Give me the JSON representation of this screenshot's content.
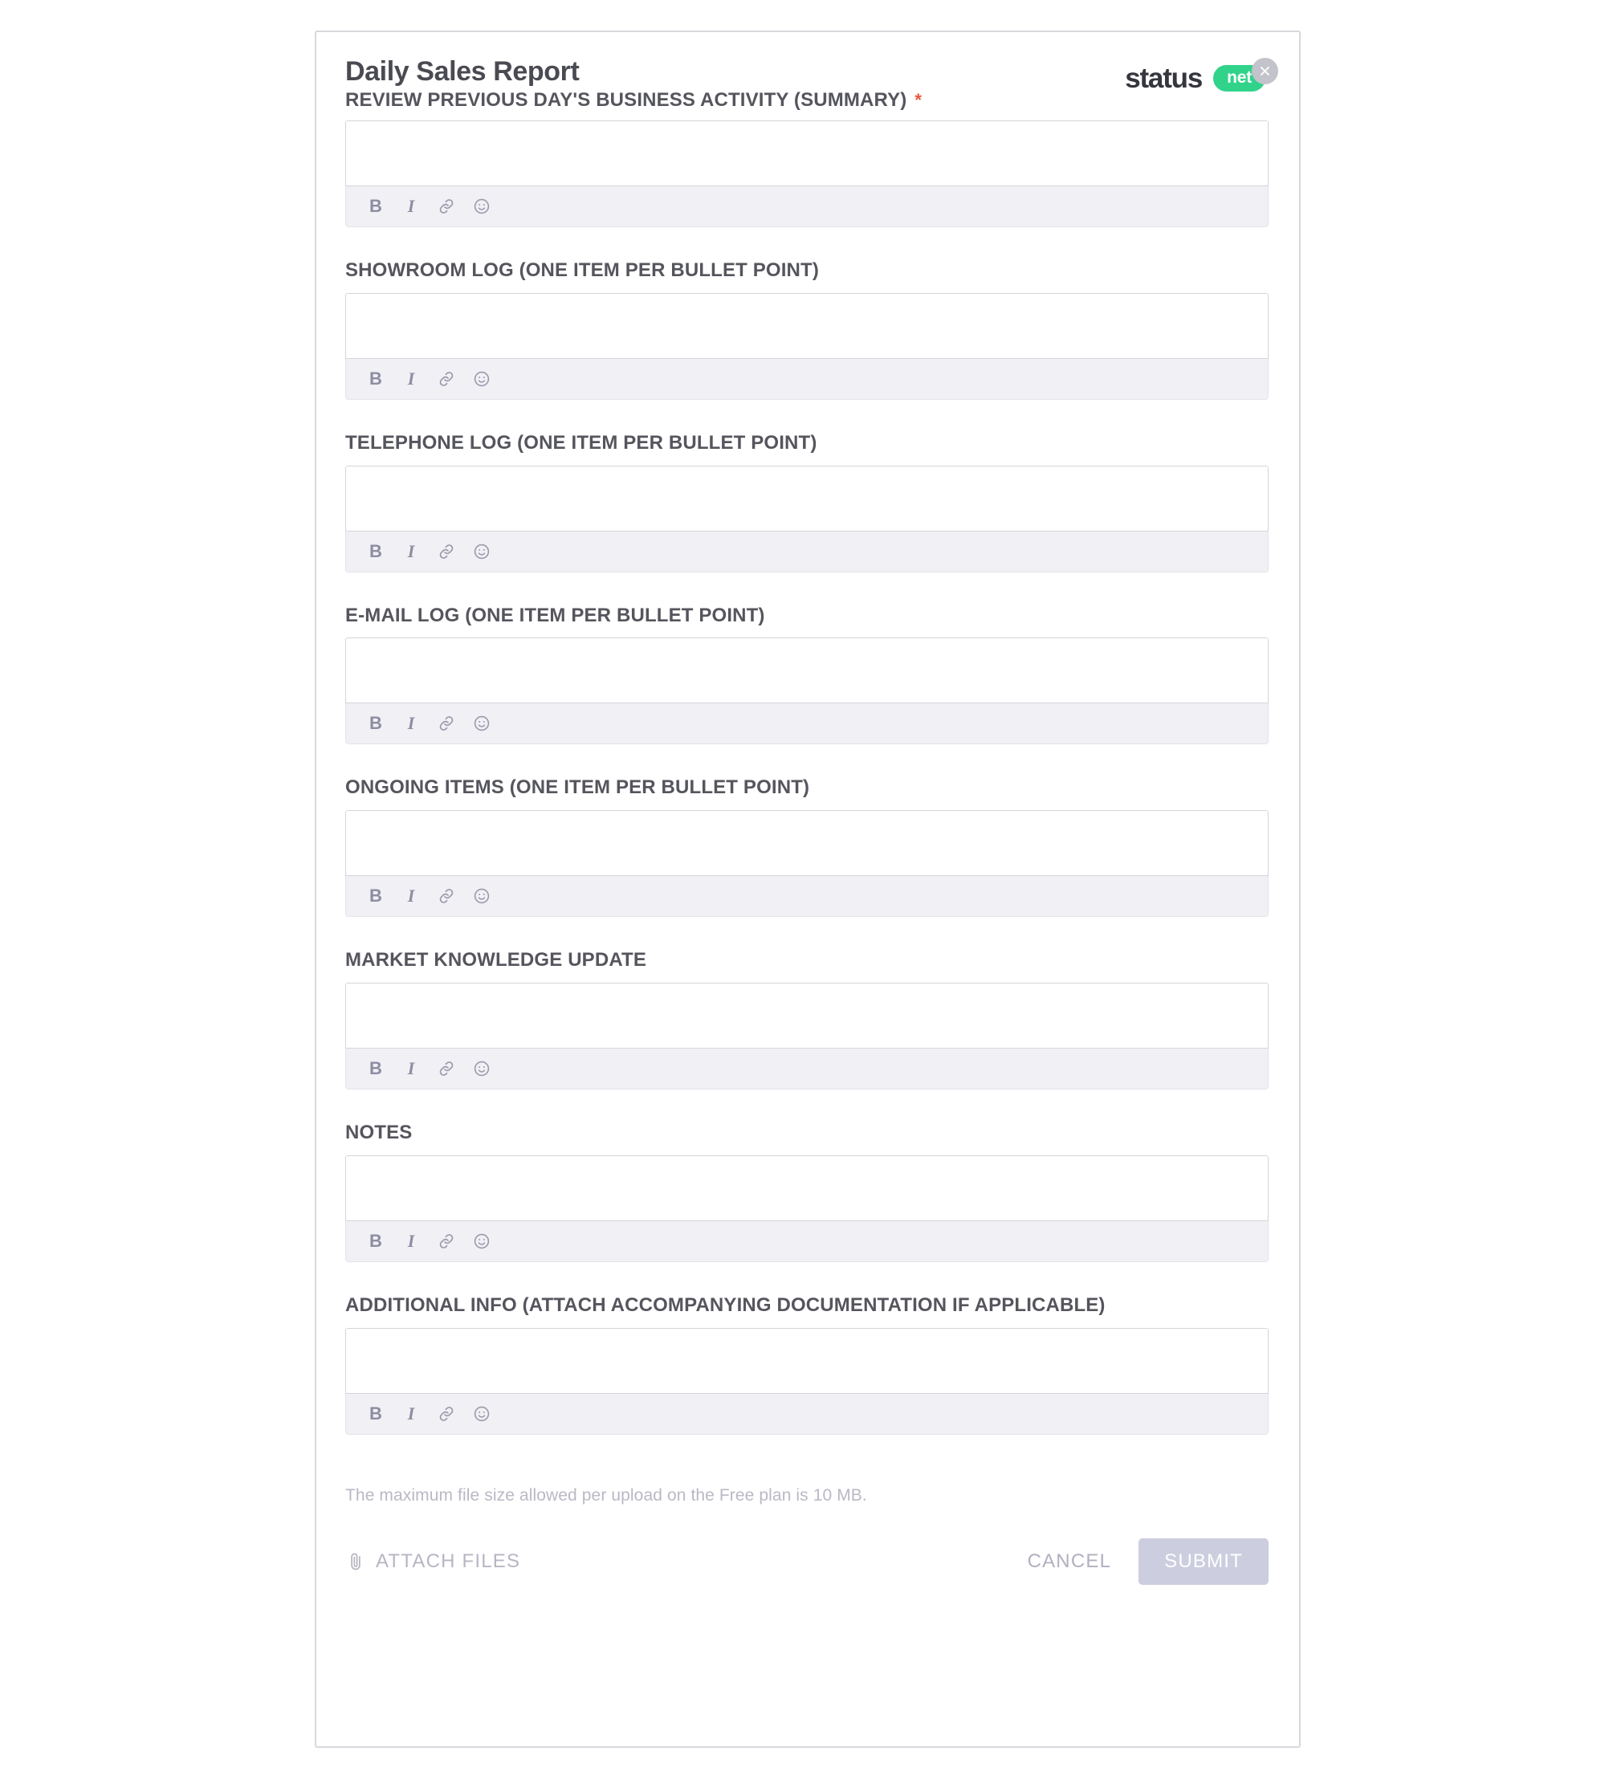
{
  "brand": {
    "word": "status",
    "pill": "net"
  },
  "header": {
    "title": "Daily Sales Report",
    "required_marker": "*"
  },
  "fields": [
    {
      "label": "REVIEW PREVIOUS DAY'S BUSINESS ACTIVITY (SUMMARY)",
      "value": "",
      "required": true
    },
    {
      "label": "SHOWROOM LOG (ONE ITEM PER BULLET POINT)",
      "value": "",
      "required": false
    },
    {
      "label": "TELEPHONE LOG (ONE ITEM PER BULLET POINT)",
      "value": "",
      "required": false
    },
    {
      "label": "E-MAIL LOG (ONE ITEM PER BULLET POINT)",
      "value": "",
      "required": false
    },
    {
      "label": "ONGOING ITEMS (ONE ITEM PER BULLET POINT)",
      "value": "",
      "required": false
    },
    {
      "label": "MARKET KNOWLEDGE UPDATE",
      "value": "",
      "required": false
    },
    {
      "label": "NOTES",
      "value": "",
      "required": false
    },
    {
      "label": "ADDITIONAL INFO (ATTACH ACCOMPANYING DOCUMENTATION IF APPLICABLE)",
      "value": "",
      "required": false
    }
  ],
  "toolbar": {
    "bold_label": "B",
    "italic_label": "I",
    "link_name": "link-icon",
    "emoji_name": "emoji-icon"
  },
  "footer": {
    "note": "The maximum file size allowed per upload on the Free plan is 10 MB.",
    "attach_label": "ATTACH FILES",
    "cancel_label": "CANCEL",
    "submit_label": "SUBMIT"
  },
  "colors": {
    "brand_green": "#31d38a",
    "required_orange": "#e8563a",
    "label_gray": "#55555d",
    "toolbar_bg": "#f0f0f5",
    "submit_disabled": "#cccdde"
  }
}
